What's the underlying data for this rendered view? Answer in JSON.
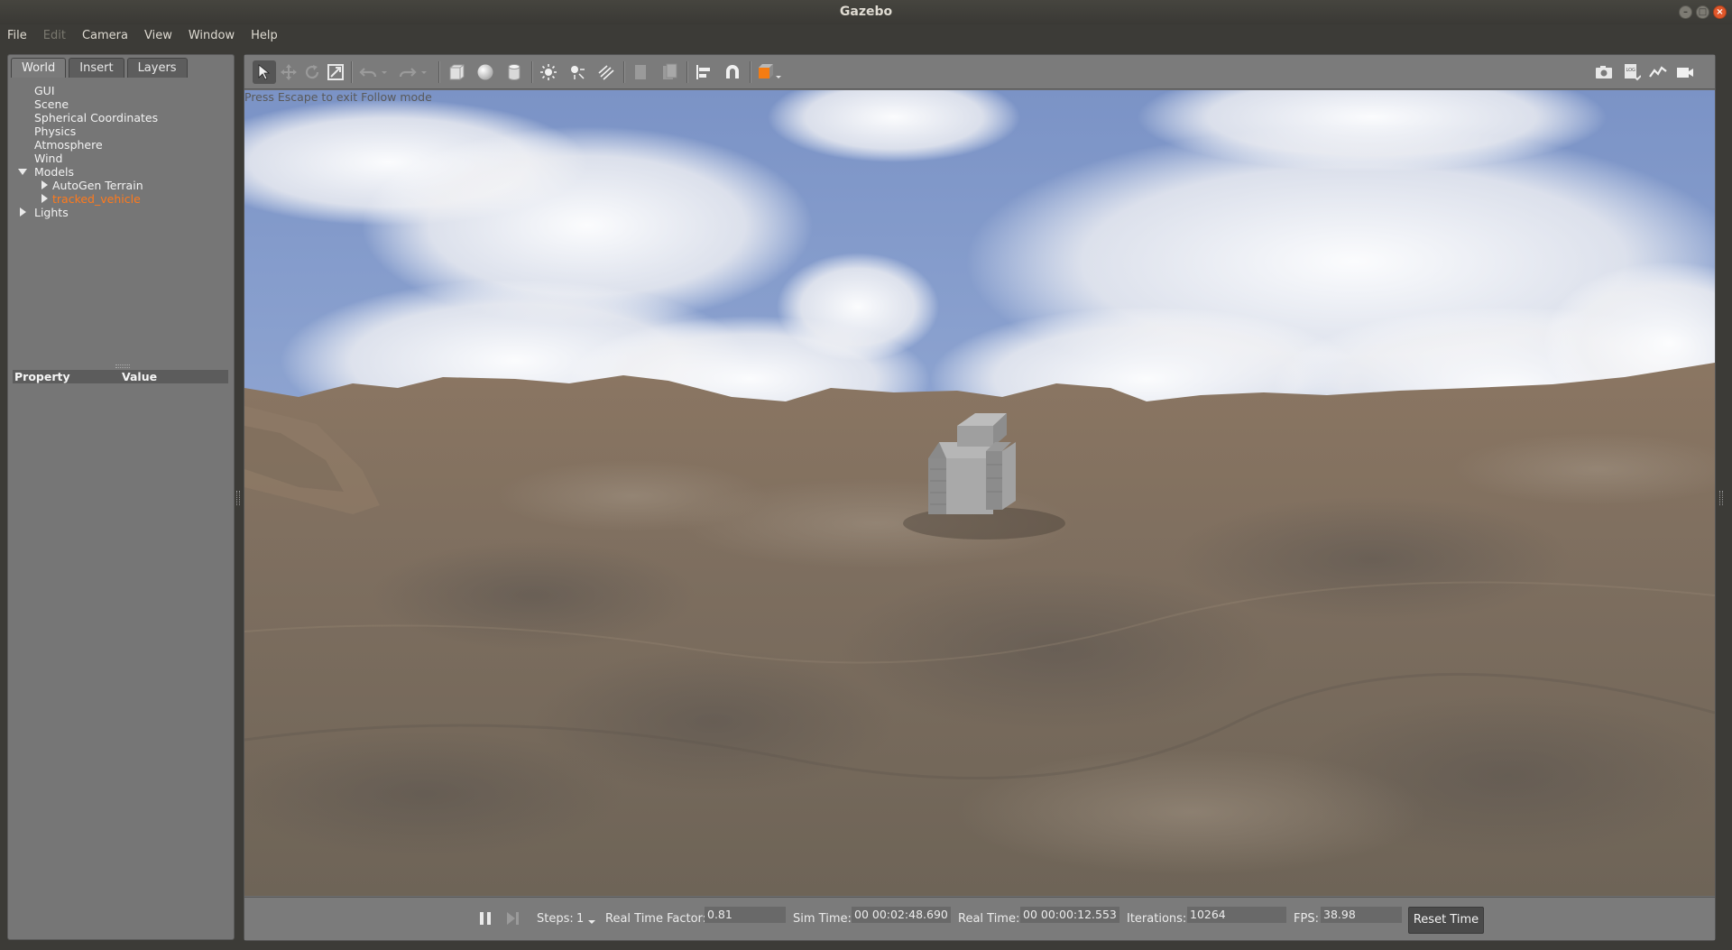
{
  "window": {
    "title": "Gazebo"
  },
  "menu": [
    "File",
    "Edit",
    "Camera",
    "View",
    "Window",
    "Help"
  ],
  "tabs": [
    "World",
    "Insert",
    "Layers"
  ],
  "tree": {
    "gui": "GUI",
    "scene": "Scene",
    "spherical": "Spherical Coordinates",
    "physics": "Physics",
    "atmosphere": "Atmosphere",
    "wind": "Wind",
    "models": "Models",
    "terrain": "AutoGen Terrain",
    "vehicle": "tracked_vehicle",
    "lights": "Lights"
  },
  "properties": {
    "col_property": "Property",
    "col_value": "Value"
  },
  "viewport": {
    "follow_message": "Press Escape to exit Follow mode"
  },
  "bottom": {
    "steps_label": "Steps:",
    "steps_value": "1",
    "rtf_label": "Real Time Factor:",
    "rtf_value": "0.81",
    "sim_label": "Sim Time:",
    "sim_value": "00 00:02:48.690",
    "real_label": "Real Time:",
    "real_value": "00 00:00:12.553",
    "iter_label": "Iterations:",
    "iter_value": "10264",
    "fps_label": "FPS:",
    "fps_value": "38.98",
    "reset_label": "Reset Time"
  },
  "colors": {
    "selected_item": "#ff7a1c",
    "accent_shape": "#f57c12"
  }
}
